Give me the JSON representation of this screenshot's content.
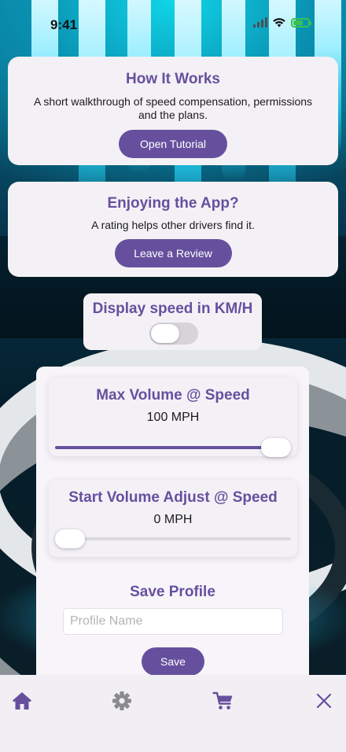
{
  "status_bar": {
    "time": "9:41"
  },
  "how_it_works": {
    "title": "How It Works",
    "description": "A short walkthrough of speed compensation, permissions and the plans.",
    "button_label": "Open Tutorial"
  },
  "review": {
    "title": "Enjoying the App?",
    "description": "A rating helps other drivers find it.",
    "button_label": "Leave a Review"
  },
  "kmh_setting": {
    "label": "Display speed in KM/H",
    "enabled": false
  },
  "max_volume": {
    "title": "Max Volume @ Speed",
    "value_text": "100 MPH",
    "slider_fraction": 1.0
  },
  "start_volume": {
    "title": "Start Volume Adjust @ Speed",
    "value_text": "0 MPH",
    "slider_fraction": 0.0
  },
  "save_profile": {
    "title": "Save Profile",
    "input_placeholder": "Profile Name",
    "input_value": "",
    "button_label": "Save"
  },
  "tab_bar": {
    "items": [
      {
        "icon": "home-icon",
        "active": true
      },
      {
        "icon": "gear-icon",
        "active": false
      },
      {
        "icon": "cart-icon",
        "active": false
      },
      {
        "icon": "close-icon",
        "active": false
      }
    ]
  },
  "colors": {
    "accent": "#66509e",
    "inactive_icon": "#8a8a8f",
    "card_bg": "#f4f1f6"
  }
}
